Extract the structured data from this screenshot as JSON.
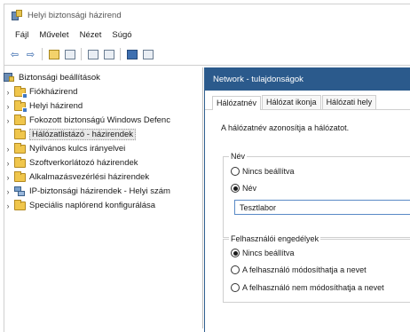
{
  "window": {
    "title": "Helyi biztonsági házirend"
  },
  "menu": [
    "Fájl",
    "Művelet",
    "Nézet",
    "Súgó"
  ],
  "toolbar": {
    "icons": [
      "back-arrow-icon",
      "forward-arrow-icon",
      "folder-up-icon",
      "show-hide-tree-icon",
      "properties-icon",
      "export-list-icon",
      "help-icon",
      "console-view-icon"
    ]
  },
  "tree": {
    "root": "Biztonsági beállítások",
    "items": [
      {
        "label": "Fiókházirend",
        "expandable": true
      },
      {
        "label": "Helyi házirend",
        "expandable": true
      },
      {
        "label": "Fokozott biztonságú Windows Defenc",
        "expandable": true
      },
      {
        "label": "Hálózatlistázó - házirendek",
        "expandable": false,
        "selected": true
      },
      {
        "label": "Nyilvános kulcs irányelvei",
        "expandable": true
      },
      {
        "label": "Szoftverkorlátozó házirendek",
        "expandable": true
      },
      {
        "label": "Alkalmazásvezérlési házirendek",
        "expandable": true
      },
      {
        "label": "IP-biztonsági házirendek - Helyi szám",
        "expandable": true
      },
      {
        "label": "Speciális naplórend konfigurálása",
        "expandable": true
      }
    ]
  },
  "dialog": {
    "title": "Network - tulajdonságok",
    "tabs": [
      "Hálózatnév",
      "Hálózat ikonja",
      "Hálózati hely"
    ],
    "description": "A hálózatnév azonosítja a hálózatot.",
    "name_group": {
      "legend": "Név",
      "option_not_configured": "Nincs beállítva",
      "option_name": "Név",
      "name_value": "Tesztlabor"
    },
    "permissions_group": {
      "legend": "Felhasználói engedélyek",
      "option_not_configured": "Nincs beállítva",
      "option_can_change": "A felhasználó módosíthatja a nevet",
      "option_cannot_change": "A felhasználó nem módosíthatja a nevet"
    }
  },
  "colors": {
    "dialog_title_bg": "#2b5a8c",
    "folder": "#f0c64c",
    "selection": "#e8e8e8"
  }
}
